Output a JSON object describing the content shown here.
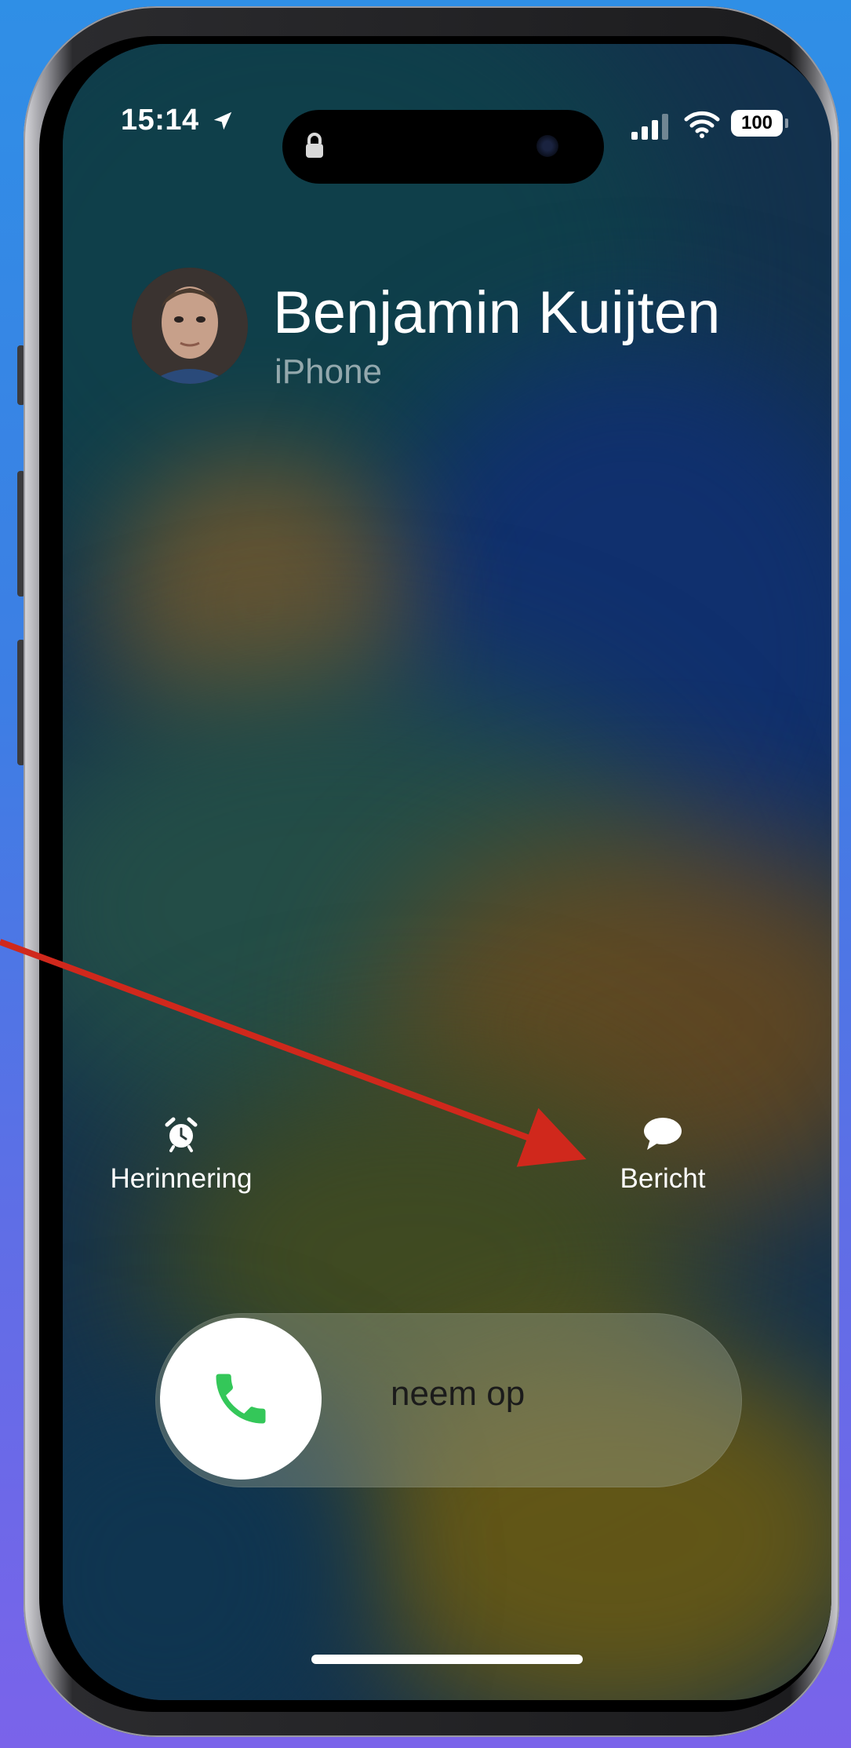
{
  "status_bar": {
    "time": "15:14",
    "battery": "100",
    "icons": [
      "location-arrow-icon",
      "lock-icon",
      "signal-icon",
      "wifi-icon",
      "battery-icon"
    ]
  },
  "caller": {
    "name": "Benjamin Kuijten",
    "source": "iPhone"
  },
  "actions": {
    "remind_label": "Herinnering",
    "message_label": "Bericht"
  },
  "slider": {
    "label": "neem op"
  },
  "colors": {
    "accept_green": "#34c759",
    "annotation_arrow": "#d0281c"
  }
}
